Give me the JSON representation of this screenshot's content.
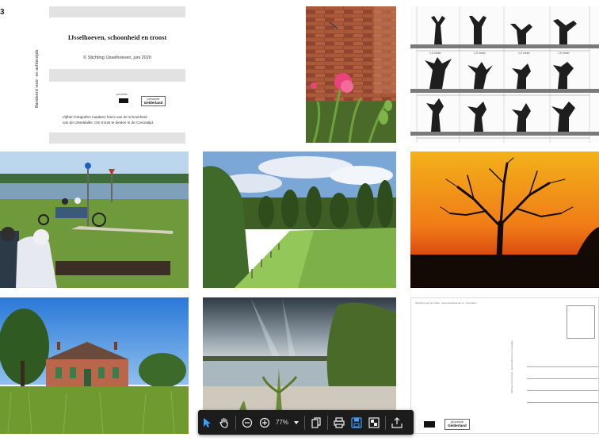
{
  "cover": {
    "corner_number": "3",
    "title": "IJsselhoeven, schoonheid en troost",
    "copyright": "© Stichting IJsselhoeven, juni 2020",
    "side_text": "Bandeerd voor- en achterzijde",
    "description_line1": "Vijftien fotografen maakten foto's van de schoonheid",
    "description_line2": "van de IJsseldallei. Om troost te bieden in de Coronatijd.",
    "logo_left_text": "provincie",
    "logo_right_line1": "provincie",
    "logo_right_line2": "Gelderland"
  },
  "willows": {
    "measure_label": "1,5 meter"
  },
  "postcard": {
    "header_text": "Stichting voor de IJssel  -  www.IJsselhoeven.nl  -  fotografen",
    "logo_right_line1": "provincie",
    "logo_right_line2": "Gelderland"
  },
  "toolbar": {
    "zoom_value": "77%",
    "buttons": [
      "select-tool",
      "hand-tool",
      "zoom-out",
      "zoom-in",
      "zoom-dropdown",
      "copy-page",
      "print",
      "save-page",
      "fit-page",
      "export"
    ]
  },
  "colors": {
    "toolbar_bg": "#1c1c1c",
    "accent_blue": "#3aa0ff",
    "icon_white": "#f0f0f0"
  }
}
